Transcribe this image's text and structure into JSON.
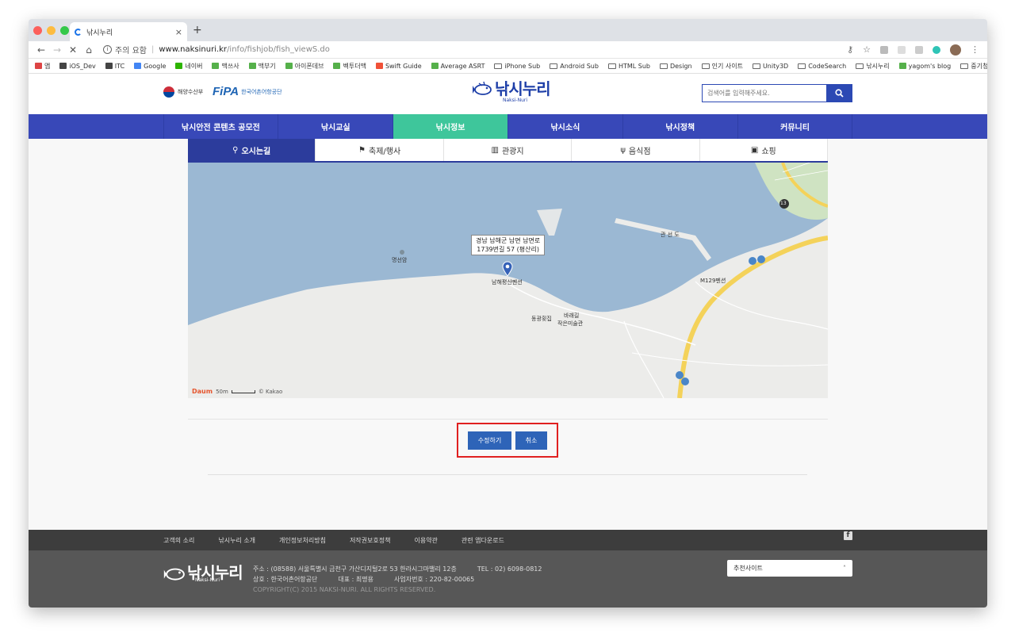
{
  "browser": {
    "tab_title": "낚시누리",
    "tab_close": "×",
    "new_tab": "+",
    "security_warning": "주의 요함",
    "url_host": "www.naksinuri.kr",
    "url_path": "/info/fishjob/fish_viewS.do"
  },
  "bookmarks": [
    {
      "label": "앱",
      "icon": "apps-grid-icon"
    },
    {
      "label": "iOS_Dev",
      "icon": "apple-icon"
    },
    {
      "label": "ITC",
      "icon": "apple-icon"
    },
    {
      "label": "Google",
      "icon": "google-icon"
    },
    {
      "label": "네이버",
      "icon": "naver-icon"
    },
    {
      "label": "맥쓰사",
      "icon": "site-icon"
    },
    {
      "label": "맥부기",
      "icon": "site-icon"
    },
    {
      "label": "아이폰데브",
      "icon": "site-icon"
    },
    {
      "label": "벡투더맥",
      "icon": "site-icon"
    },
    {
      "label": "Swift Guide",
      "icon": "swift-icon"
    },
    {
      "label": "Average ASRT",
      "icon": "site-icon"
    },
    {
      "label": "iPhone Sub",
      "icon": "folder-icon"
    },
    {
      "label": "Android Sub",
      "icon": "folder-icon"
    },
    {
      "label": "HTML Sub",
      "icon": "folder-icon"
    },
    {
      "label": "Design",
      "icon": "folder-icon"
    },
    {
      "label": "인기 사이트",
      "icon": "folder-icon"
    },
    {
      "label": "Unity3D",
      "icon": "folder-icon"
    },
    {
      "label": "CodeSearch",
      "icon": "folder-icon"
    },
    {
      "label": "낚시누리",
      "icon": "folder-icon"
    },
    {
      "label": "yagom's blog",
      "icon": "site-icon"
    },
    {
      "label": "중기청",
      "icon": "folder-icon"
    }
  ],
  "bookmarks_more": "»",
  "header": {
    "gov_name": "해양수산부",
    "fipa_mark": "FiPA",
    "fipa_name": "한국어촌어항공단",
    "logo_text": "낚시누리",
    "logo_sub": "Naksi-Nuri",
    "search_placeholder": "검색어를 입력해주세요."
  },
  "nav": [
    {
      "label": "낚시안전 콘텐츠 공모전",
      "active": false
    },
    {
      "label": "낚시교실",
      "active": false
    },
    {
      "label": "낚시정보",
      "active": true
    },
    {
      "label": "낚시소식",
      "active": false
    },
    {
      "label": "낚시정책",
      "active": false
    },
    {
      "label": "커뮤니티",
      "active": false
    }
  ],
  "sub_tabs": [
    {
      "label": "오시는길",
      "icon": "map-pin-icon",
      "active": true
    },
    {
      "label": "축제/행사",
      "icon": "flag-icon",
      "active": false
    },
    {
      "label": "관광지",
      "icon": "map-icon",
      "active": false
    },
    {
      "label": "음식점",
      "icon": "cutlery-icon",
      "active": false
    },
    {
      "label": "쇼핑",
      "icon": "shopping-icon",
      "active": false
    }
  ],
  "map": {
    "address_line1": "경남 남해군 남면 남면로",
    "address_line2": "1739번길 57 (평산리)",
    "place_main": "남해평산펜션",
    "place_island": "명선암",
    "place_gwanseondo": "관 선 도",
    "place_m129": "M129펜션",
    "place_donggwang": "동광횟집",
    "place_gallery_1": "바래길",
    "place_gallery_2": "작은미술관",
    "road_number": "13",
    "scale": "50m",
    "attribution": "© Kakao",
    "brand": "Daum"
  },
  "buttons": {
    "edit": "수정하기",
    "cancel": "취소"
  },
  "footer": {
    "links": [
      "고객의 소리",
      "낚시누리 소개",
      "개인정보처리방침",
      "저작권보호정책",
      "이용약관",
      "관련 앱다운로드"
    ],
    "logo_text": "낚시누리",
    "logo_sub": "Naksi-Nuri",
    "address": "주소 : (08588) 서울특별시 금천구 가산디지털2로 53 한라시그마밸리 12층",
    "tel": "TEL : 02) 6098-0812",
    "company": "상호 : 한국어촌어항공단",
    "ceo": "대표 : 최명용",
    "biz_no": "사업자번호 : 220-82-00065",
    "copyright": "COPYRIGHT(C) 2015 NAKSI-NURI. ALL RIGHTS RESERVED.",
    "recommend": "추천사이트",
    "facebook_glyph": "f"
  },
  "colors": {
    "nav_bg": "#3848b8",
    "nav_active": "#3ec69b",
    "subtab_active": "#2c3c9c",
    "button_bg": "#2e64b8",
    "highlight_box": "#e02020",
    "sea": "#9bb8d3",
    "land": "#ececea"
  }
}
